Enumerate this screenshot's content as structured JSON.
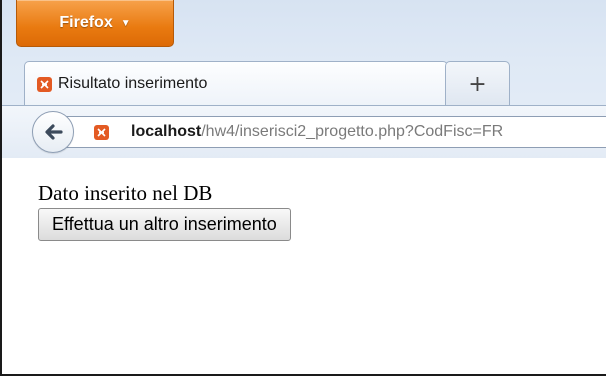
{
  "app": {
    "menu_label": "Firefox"
  },
  "tabs": [
    {
      "title": "Risultato inserimento"
    }
  ],
  "new_tab_label": "+",
  "address": {
    "host": "localhost",
    "path": "/hw4/inserisci2_progetto.php?CodFisc=FR"
  },
  "page": {
    "message": "Dato inserito nel DB",
    "button_label": "Effettua un altro inserimento"
  },
  "colors": {
    "firefox_button": "#e97a10",
    "favicon": "#e35a23",
    "chrome_bg": "#dfe9f5"
  },
  "icons": {
    "firefox_menu": "caret-down-icon",
    "tab_favicon": "xampp-favicon-icon",
    "back": "back-arrow-icon",
    "url_favicon": "xampp-favicon-icon"
  }
}
